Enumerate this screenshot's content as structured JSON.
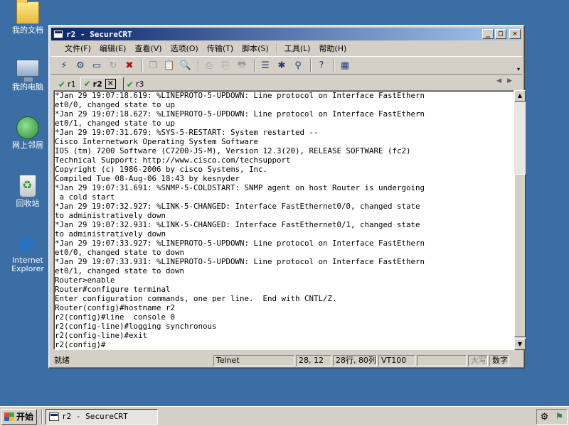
{
  "desktop": {
    "icons": [
      {
        "label": "我的文档",
        "icon": "my-documents-icon"
      },
      {
        "label": "我的电脑",
        "icon": "my-computer-icon"
      },
      {
        "label": "网上邻居",
        "icon": "network-places-icon"
      },
      {
        "label": "回收站",
        "icon": "recycle-bin-icon"
      },
      {
        "label": "Internet Explorer",
        "icon": "internet-explorer-icon"
      }
    ]
  },
  "window": {
    "title": "r2 - SecureCRT",
    "controls": {
      "minimize": "_",
      "maximize": "□",
      "close": "✕"
    }
  },
  "menu": [
    "文件(F)",
    "编辑(E)",
    "查看(V)",
    "选项(O)",
    "传输(T)",
    "脚本(S)",
    "工具(L)",
    "帮助(H)"
  ],
  "tabs": [
    {
      "label": "r1",
      "active": false
    },
    {
      "label": "r2",
      "active": true
    },
    {
      "label": "r3",
      "active": false
    }
  ],
  "tab_close": "✕",
  "terminal": {
    "lines": [
      "*Jan 29 19:07:18.619: %LINEPROTO-5-UPDOWN: Line protocol on Interface FastEthern",
      "et0/0, changed state to up",
      "*Jan 29 19:07:18.627: %LINEPROTO-5-UPDOWN: Line protocol on Interface FastEthern",
      "et0/1, changed state to up",
      "*Jan 29 19:07:31.679: %SYS-5-RESTART: System restarted --",
      "Cisco Internetwork Operating System Software",
      "IOS (tm) 7200 Software (C7200-JS-M), Version 12.3(20), RELEASE SOFTWARE (fc2)",
      "Technical Support: http://www.cisco.com/techsupport",
      "Copyright (c) 1986-2006 by cisco Systems, Inc.",
      "Compiled Tue 08-Aug-06 18:43 by kesnyder",
      "*Jan 29 19:07:31.691: %SNMP-5-COLDSTART: SNMP agent on host Router is undergoing",
      " a cold start",
      "*Jan 29 19:07:32.927: %LINK-5-CHANGED: Interface FastEthernet0/0, changed state",
      "to administratively down",
      "*Jan 29 19:07:32.931: %LINK-5-CHANGED: Interface FastEthernet0/1, changed state",
      "to administratively down",
      "*Jan 29 19:07:33.927: %LINEPROTO-5-UPDOWN: Line protocol on Interface FastEthern",
      "et0/0, changed state to down",
      "*Jan 29 19:07:33.931: %LINEPROTO-5-UPDOWN: Line protocol on Interface FastEthern",
      "et0/1, changed state to down",
      "Router>enable",
      "Router#configure terminal",
      "Enter configuration commands, one per line.  End with CNTL/Z.",
      "Router(config)#hostname r2",
      "r2(config)#line  console 0",
      "r2(config-line)#logging synchronous",
      "r2(config-line)#exit",
      "r2(config)#"
    ]
  },
  "status": {
    "ready": "就绪",
    "protocol": "Telnet",
    "cursor": "28, 12",
    "size": "28行, 80列",
    "emulation": "VT100",
    "caps": "大写",
    "num": "数字"
  },
  "taskbar": {
    "start": "开始",
    "task": "r2 - SecureCRT"
  },
  "colors": {
    "desktop": "#3a6ea5",
    "titlebar_start": "#0a246a",
    "titlebar_end": "#a6caf0",
    "chrome": "#d4d0c8",
    "check": "#1d9a1d"
  }
}
